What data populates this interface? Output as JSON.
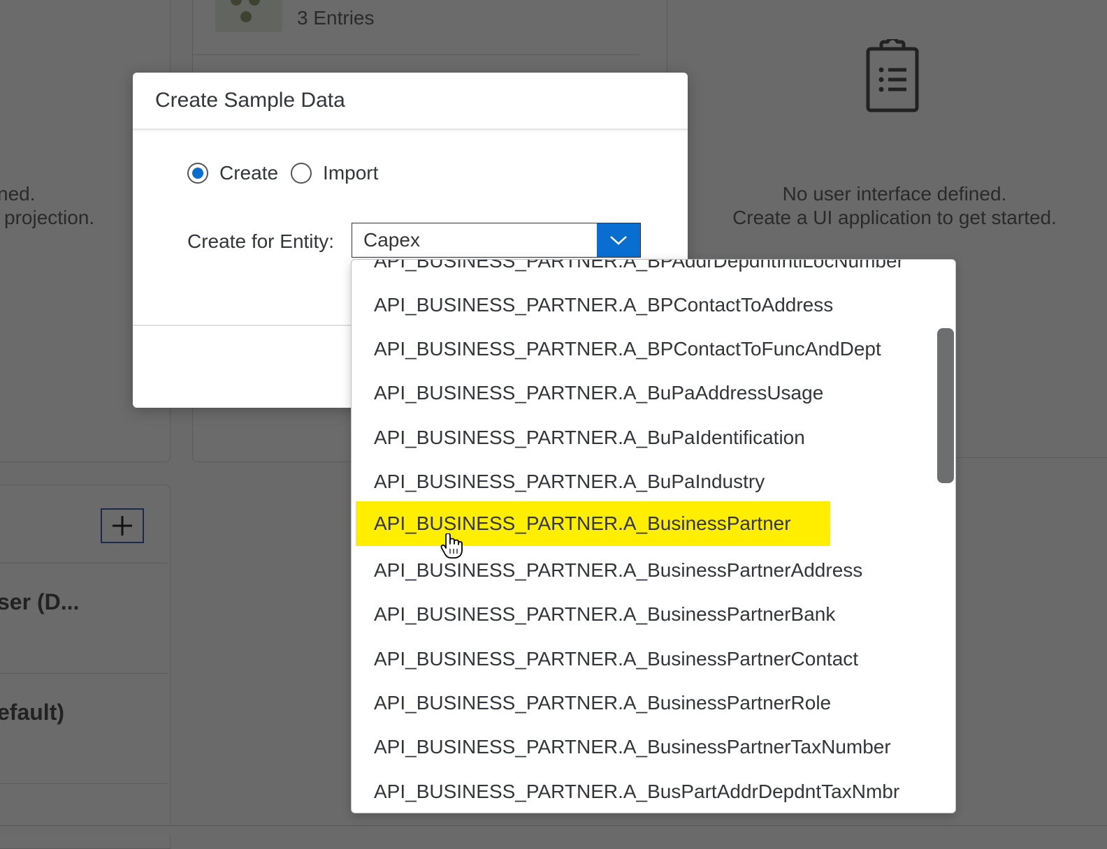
{
  "background": {
    "entries_label": "3 Entries",
    "left_partial_line1": "ned.",
    "left_partial_line2": "projection.",
    "no_ui_line1": "No user interface defined.",
    "no_ui_line2": "Create a UI application to get started.",
    "user_partial": "ser (D...",
    "default_partial": "efault)",
    "add_button_icon": "plus-icon",
    "clipboard_icon": "clipboard-list-icon"
  },
  "dialog": {
    "title": "Create Sample Data",
    "mode_options": [
      {
        "label": "Create",
        "selected": true
      },
      {
        "label": "Import",
        "selected": false
      }
    ],
    "entity_label": "Create for Entity:",
    "entity_value": "Capex",
    "accent_color": "#0a6ed1"
  },
  "dropdown": {
    "highlight_color": "#ffee00",
    "options": [
      "API_BUSINESS_PARTNER.A_BPAddrDepdntIntlLocNumber",
      "API_BUSINESS_PARTNER.A_BPContactToAddress",
      "API_BUSINESS_PARTNER.A_BPContactToFuncAndDept",
      "API_BUSINESS_PARTNER.A_BuPaAddressUsage",
      "API_BUSINESS_PARTNER.A_BuPaIdentification",
      "API_BUSINESS_PARTNER.A_BuPaIndustry",
      "API_BUSINESS_PARTNER.A_BusinessPartner",
      "API_BUSINESS_PARTNER.A_BusinessPartnerAddress",
      "API_BUSINESS_PARTNER.A_BusinessPartnerBank",
      "API_BUSINESS_PARTNER.A_BusinessPartnerContact",
      "API_BUSINESS_PARTNER.A_BusinessPartnerRole",
      "API_BUSINESS_PARTNER.A_BusinessPartnerTaxNumber",
      "API_BUSINESS_PARTNER.A_BusPartAddrDepdntTaxNmbr"
    ],
    "highlighted_index": 6
  }
}
